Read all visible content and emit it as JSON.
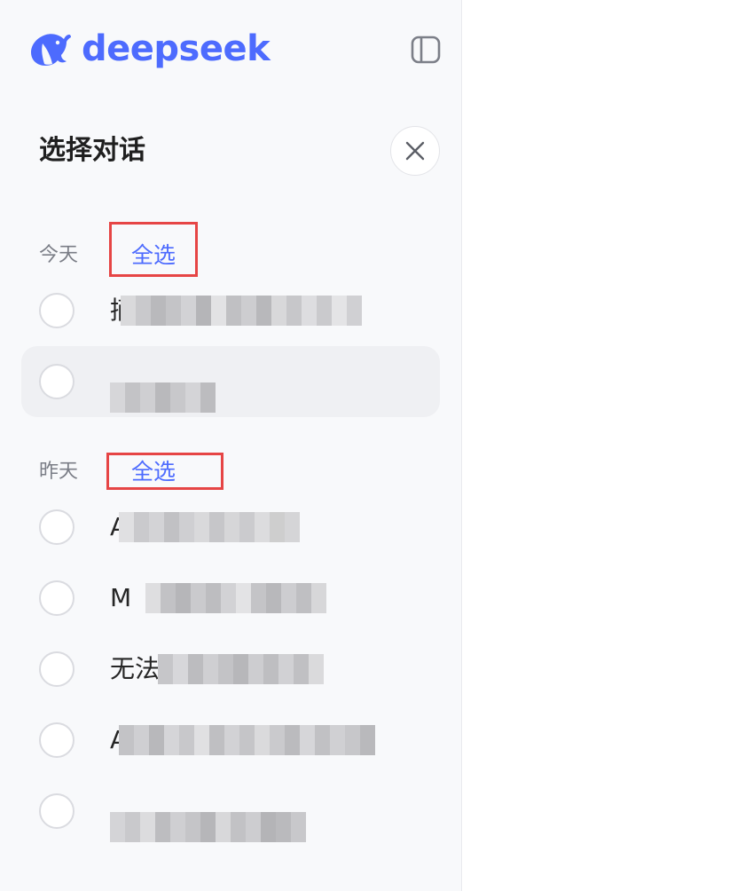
{
  "brand": {
    "name": "deepseek",
    "color": "#4d6bfe"
  },
  "header": {
    "toggle_icon": "sidebar-toggle-icon"
  },
  "panel": {
    "title": "选择对话",
    "close_icon": "close-icon"
  },
  "groups": [
    {
      "label": "今天",
      "select_all": "全选",
      "items": [
        {
          "text": "摘",
          "hovered": false
        },
        {
          "text": "",
          "hovered": true
        }
      ]
    },
    {
      "label": "昨天",
      "select_all": "全选",
      "items": [
        {
          "text": "A",
          "hovered": false
        },
        {
          "text": "M",
          "hovered": false
        },
        {
          "text": "无法",
          "hovered": false
        },
        {
          "text": "A",
          "hovered": false
        },
        {
          "text": "",
          "hovered": false
        }
      ]
    }
  ],
  "colors": {
    "accent": "#4d6bfe",
    "highlight_box": "#e64545"
  }
}
